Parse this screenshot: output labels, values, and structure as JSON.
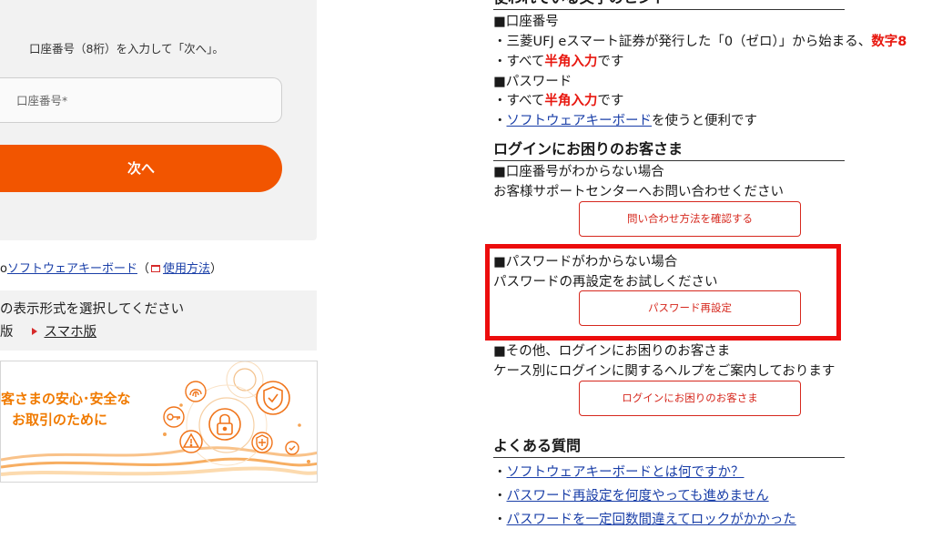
{
  "login": {
    "instruction": "口座番号（8桁）を入力して「次へ」。",
    "account_placeholder": "口座番号*",
    "next_label": "次へ"
  },
  "keyboard_row": {
    "prefix": "o",
    "link": "ソフトウェアキーボード",
    "paren_open": "（",
    "usage_link": "使用方法",
    "paren_close": "）"
  },
  "display": {
    "prompt": "の表示形式を選択してください",
    "pc_label": "版",
    "smartphone_link": "スマホ版"
  },
  "banner": {
    "line1": "客さまの安心･安全な",
    "line2": "お取引のために",
    "icons": [
      "fingerprint-icon",
      "key-icon",
      "padlock-icon",
      "shield-check-icon",
      "warning-icon",
      "shield-cross-icon",
      "check-circle-icon"
    ]
  },
  "hints": {
    "heading_partial": "使われている文字のヒント",
    "account_heading": "■口座番号",
    "account_line1_prefix": "・三菱UFJ eスマート証券が発行した「0（ゼロ）」から始まる、",
    "account_line1_red": "数字8",
    "account_line2_prefix": "・すべて",
    "account_line2_red": "半角入力",
    "account_line2_suffix": "です",
    "password_heading": "■パスワード",
    "password_line1_prefix": "・すべて",
    "password_line1_red": "半角入力",
    "password_line1_suffix": "です",
    "password_line2_prefix": "・",
    "password_line2_link": "ソフトウェアキーボード",
    "password_line2_suffix": "を使うと便利です"
  },
  "trouble": {
    "heading": "ログインにお困りのお客さま",
    "account_unknown": "■口座番号がわからない場合",
    "account_unknown_desc": "お客様サポートセンターへお問い合わせください",
    "contact_button": "問い合わせ方法を確認する",
    "password_unknown": "■パスワードがわからない場合",
    "password_unknown_desc": "パスワードの再設定をお試しください",
    "reset_button": "パスワード再設定",
    "other": "■その他、ログインにお困りのお客さま",
    "other_desc": "ケース別にログインに関するヘルプをご案内しております",
    "help_button": "ログインにお困りのお客さま"
  },
  "faq": {
    "heading": "よくある質問",
    "items": [
      "ソフトウェアキーボードとは何ですか？",
      "パスワード再設定を何度やっても進めません",
      "パスワードを一定回数間違えてロックがかかった"
    ]
  },
  "colors": {
    "accent": "#f25500",
    "emphasis_red": "#e8170f",
    "highlight_frame": "#ec0d0d",
    "link": "#1a3fa8"
  }
}
